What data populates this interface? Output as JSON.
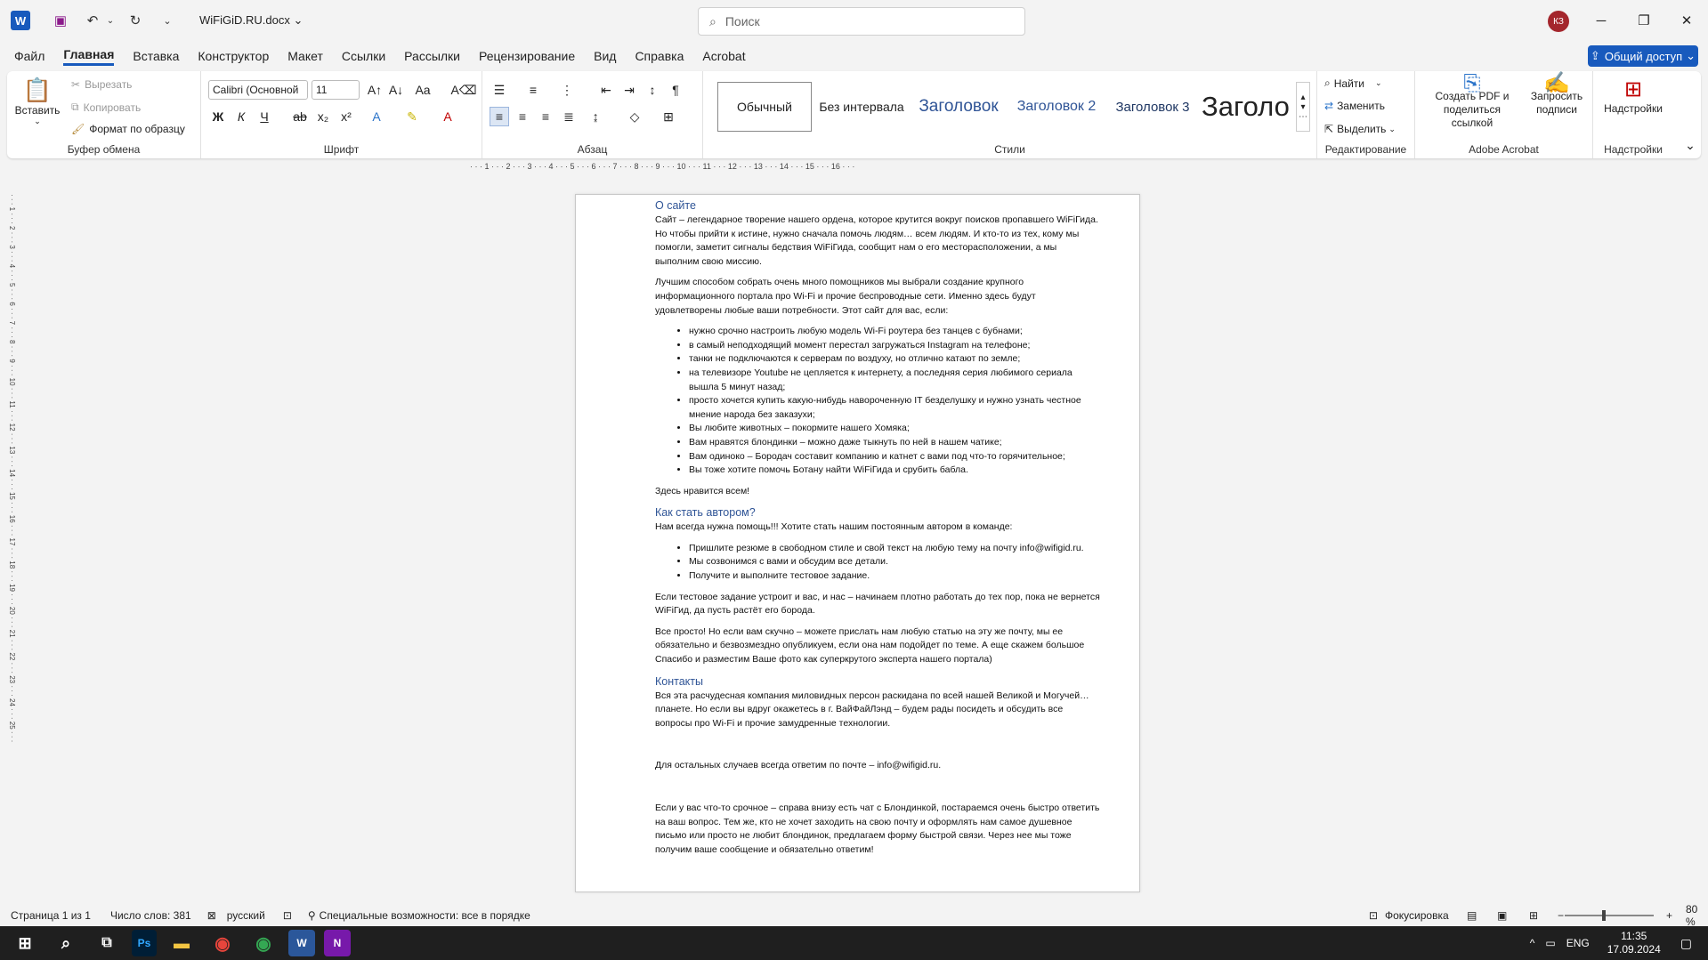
{
  "titlebar": {
    "app_logo": "W",
    "doc_name": "WiFiGiD.RU.docx",
    "search_placeholder": "Поиск",
    "avatar": "КЗ"
  },
  "menu": [
    "Файл",
    "Главная",
    "Вставка",
    "Конструктор",
    "Макет",
    "Ссылки",
    "Рассылки",
    "Рецензирование",
    "Вид",
    "Справка",
    "Acrobat"
  ],
  "share_label": "Общий доступ",
  "ribbon": {
    "clipboard": {
      "paste": "Вставить",
      "cut": "Вырезать",
      "copy": "Копировать",
      "format_painter": "Формат по образцу",
      "label": "Буфер обмена"
    },
    "font": {
      "name": "Calibri (Основной",
      "size": "11",
      "label": "Шрифт"
    },
    "paragraph": {
      "label": "Абзац"
    },
    "styles": {
      "items": [
        "Обычный",
        "Без интервала",
        "Заголовок",
        "Заголовок 2",
        "Заголовок 3",
        "Заголо"
      ],
      "label": "Стили"
    },
    "editing": {
      "find": "Найти",
      "replace": "Заменить",
      "select": "Выделить",
      "label": "Редактирование"
    },
    "acrobat": {
      "create_pdf": "Создать PDF и поделиться ссылкой",
      "request_sign": "Запросить подписи",
      "label": "Adobe Acrobat"
    },
    "addins": {
      "addins": "Надстройки",
      "label": "Надстройки"
    }
  },
  "document": {
    "h_about": "О сайте",
    "p1": "Сайт – легендарное творение нашего ордена, которое крутится вокруг поисков пропавшего WiFiГида. Но чтобы прийти к истине, нужно сначала помочь людям… всем людям. И кто-то из тех, кому мы помогли, заметит сигналы бедствия WiFiГида, сообщит нам о его месторасположении, а мы выполним свою миссию.",
    "p2": "Лучшим способом собрать очень много помощников мы выбрали создание крупного информационного портала про Wi-Fi и прочие беспроводные сети. Именно здесь будут удовлетворены любые ваши потребности. Этот сайт для вас, если:",
    "list1": [
      "нужно срочно настроить любую модель Wi-Fi роутера без танцев с бубнами;",
      "в самый неподходящий момент перестал загружаться Instagram на телефоне;",
      "танки не подключаются к серверам по воздуху, но отлично катают по земле;",
      "на телевизоре Youtube не цепляется к интернету, а последняя серия любимого сериала вышла 5 минут назад;",
      "просто хочется купить какую-нибудь навороченную IT безделушку и нужно узнать честное мнение народа без заказухи;",
      "Вы любите животных – покормите нашего Хомяка;",
      "Вам нравятся блондинки – можно даже тыкнуть по ней в нашем чатике;",
      "Вам одиноко – Бородач составит компанию и катнет с вами под что-то горячительное;",
      "Вы тоже хотите помочь Ботану найти WiFiГида и срубить бабла."
    ],
    "p3": "Здесь нравится всем!",
    "h_author": "Как стать автором?",
    "p4": "Нам всегда нужна помощь!!! Хотите стать нашим постоянным автором в команде:",
    "list2": [
      "Пришлите резюме в свободном стиле и свой текст на любую тему на почту info@wifigid.ru.",
      "Мы созвонимся с вами и обсудим все детали.",
      "Получите и выполните тестовое задание."
    ],
    "p5": "Если тестовое задание устроит и вас, и нас – начинаем плотно работать до тех пор, пока не вернется WiFiГид, да пусть растёт его борода.",
    "p6": "Все просто! Но если вам скучно – можете прислать нам любую статью на эту же почту, мы ее обязательно и безвозмездно опубликуем, если она нам подойдет по теме. А еще скажем большое Спасибо и разместим Ваше фото как суперкрутого эксперта нашего портала)",
    "h_contacts": "Контакты",
    "p7": "Вся эта расчудесная компания миловидных персон раскидана по всей нашей Великой и Могучей… планете. Но если вы вдруг окажетесь в г. ВайФайЛэнд – будем рады посидеть и обсудить все вопросы про Wi-Fi и прочие замудренные технологии.",
    "p8": "Для остальных случаев всегда ответим по почте – info@wifigid.ru.",
    "p9": "Если у вас что-то срочное – справа внизу есть чат с Блондинкой, постараемся очень быстро ответить на ваш вопрос. Тем же, кто не хочет заходить на свою почту и оформлять нам самое душевное письмо или просто не любит блондинок, предлагаем форму быстрой связи. Через нее мы тоже получим ваше сообщение и обязательно ответим!"
  },
  "status": {
    "page": "Страница 1 из 1",
    "words": "Число слов: 381",
    "lang": "русский",
    "accessibility": "Специальные возможности: все в порядке",
    "focus": "Фокусировка",
    "zoom": "80 %"
  },
  "taskbar": {
    "lang": "ENG",
    "time": "11:35",
    "date": "17.09.2024"
  }
}
